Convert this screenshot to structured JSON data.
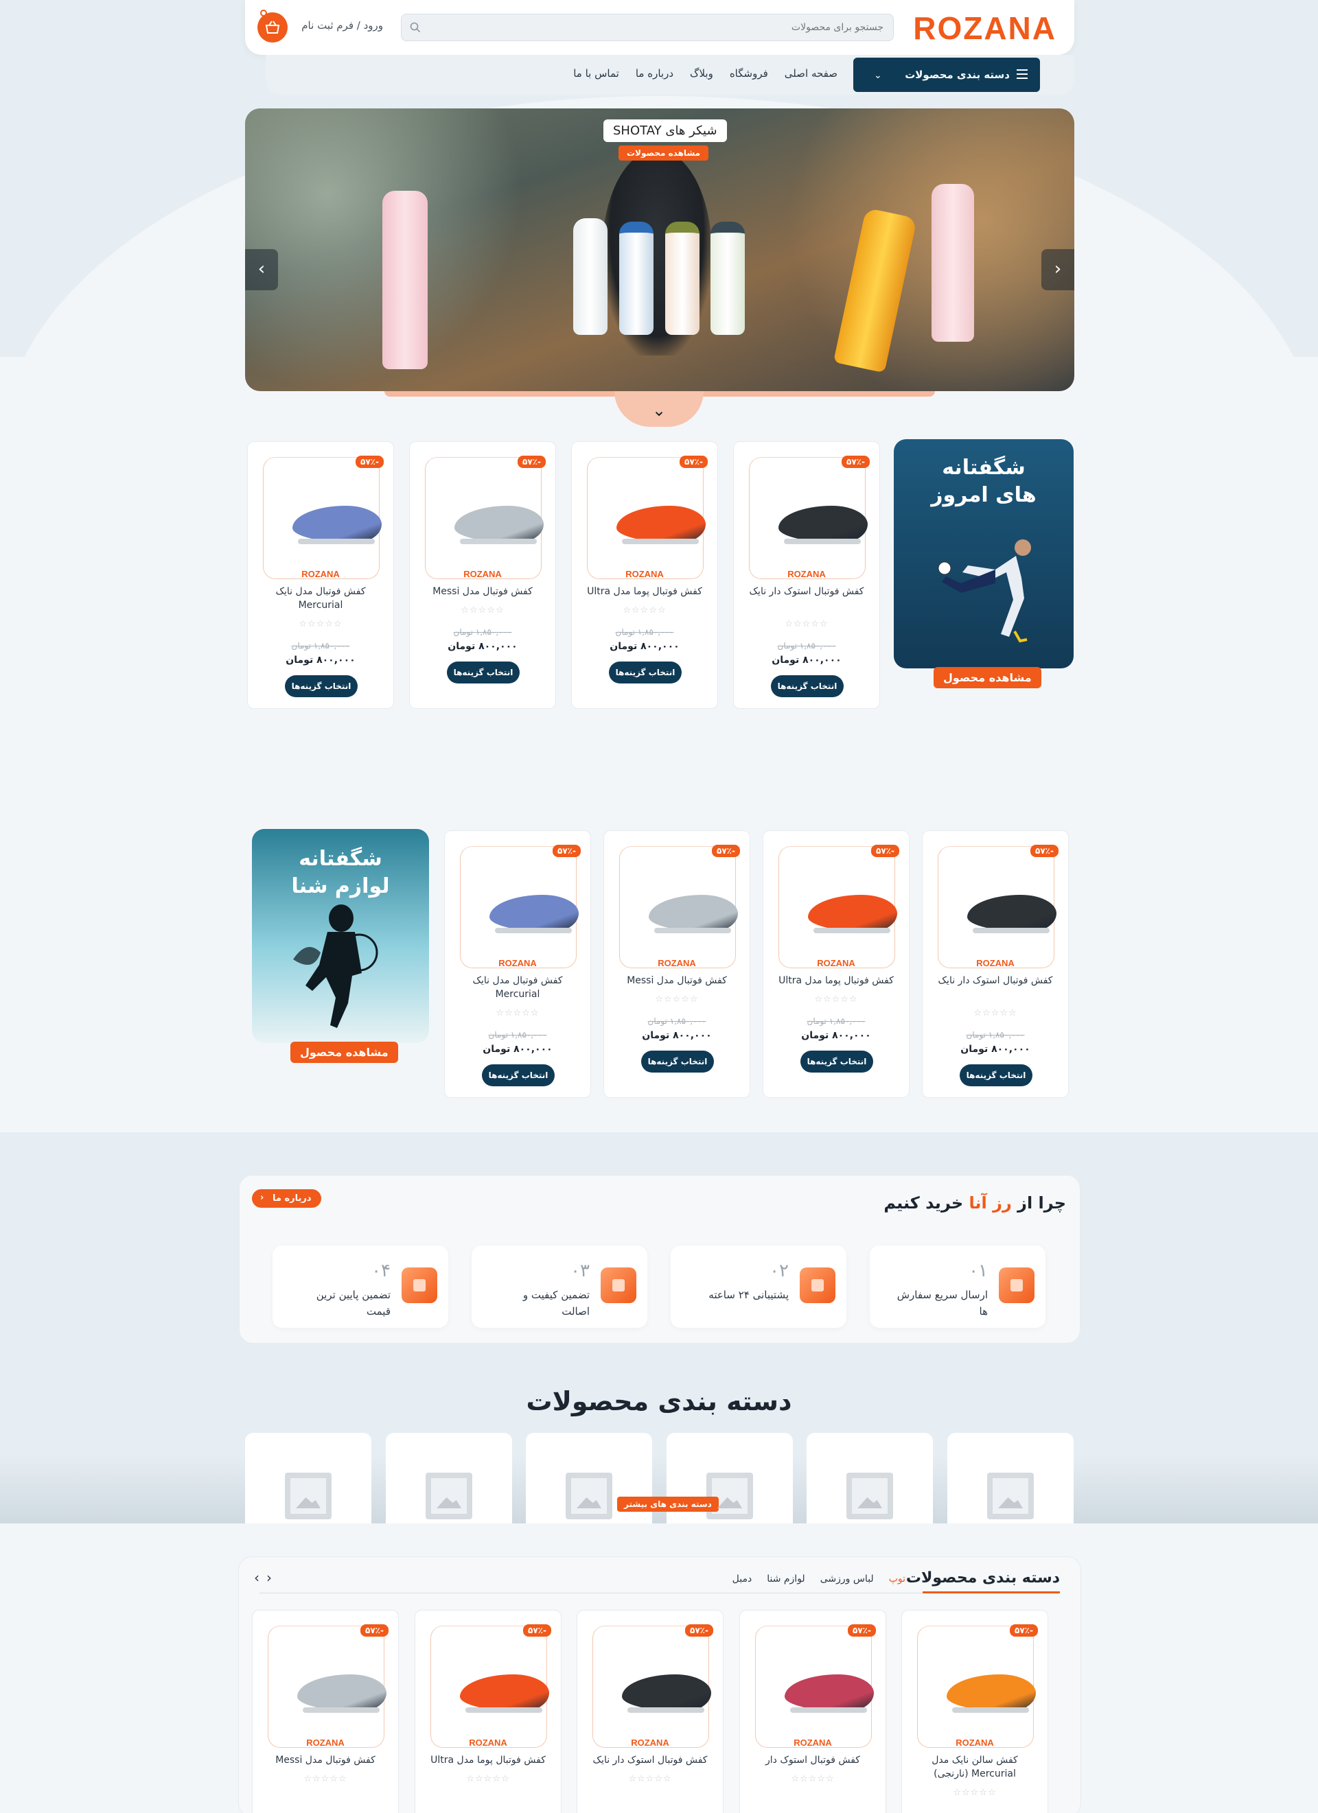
{
  "header": {
    "logo": "ROZANA",
    "search_placeholder": "جستجو برای محصولات",
    "login": "ورود / فرم ثبت نام"
  },
  "nav": {
    "category_menu": "دسته بندی محصولات",
    "links": [
      "صفحه اصلی",
      "فروشگاه",
      "وبلاگ",
      "درباره ما",
      "تماس با ما"
    ]
  },
  "hero": {
    "title": "شیکر های SHOTAY",
    "cta": "مشاهده محصولات"
  },
  "offer1": {
    "title_line1": "شگفتانه",
    "title_line2": "های امروز",
    "button": "مشاهده محصول",
    "products": [
      {
        "title": "کفش فوتبال استوک دار نایک",
        "discount": "-۵۷٪",
        "brand": "ROZANA",
        "stars": "☆☆☆☆☆",
        "old_price": "۱,۸۵۰,۰۰۰ تومان",
        "price": "۸۰۰,۰۰۰ تومان",
        "button": "انتخاب گزینه‌ها",
        "color": "#2d3236"
      },
      {
        "title": "کفش فوتبال پوما مدل Ultra",
        "discount": "-۵۷٪",
        "brand": "ROZANA",
        "stars": "☆☆☆☆☆",
        "old_price": "۱,۸۵۰,۰۰۰ تومان",
        "price": "۸۰۰,۰۰۰ تومان",
        "button": "انتخاب گزینه‌ها",
        "color": "#f0501e"
      },
      {
        "title": "کفش فوتبال مدل Messi",
        "discount": "-۵۷٪",
        "brand": "ROZANA",
        "stars": "☆☆☆☆☆",
        "old_price": "۱,۸۵۰,۰۰۰ تومان",
        "price": "۸۰۰,۰۰۰ تومان",
        "button": "انتخاب گزینه‌ها",
        "color": "#b9c2c8"
      },
      {
        "title": "کفش فوتبال مدل نایک Mercurial",
        "discount": "-۵۷٪",
        "brand": "ROZANA",
        "stars": "☆☆☆☆☆",
        "old_price": "۱,۸۵۰,۰۰۰ تومان",
        "price": "۸۰۰,۰۰۰ تومان",
        "button": "انتخاب گزینه‌ها",
        "color": "#6f86c9"
      }
    ]
  },
  "offer2": {
    "title_line1": "شگفتانه",
    "title_line2": "لوازم شنا",
    "button": "مشاهده محصول",
    "products": [
      {
        "title": "کفش فوتبال استوک دار نایک",
        "discount": "-۵۷٪",
        "brand": "ROZANA",
        "stars": "☆☆☆☆☆",
        "old_price": "۱,۸۵۰,۰۰۰ تومان",
        "price": "۸۰۰,۰۰۰ تومان",
        "button": "انتخاب گزینه‌ها",
        "color": "#2d3236"
      },
      {
        "title": "کفش فوتبال پوما مدل Ultra",
        "discount": "-۵۷٪",
        "brand": "ROZANA",
        "stars": "☆☆☆☆☆",
        "old_price": "۱,۸۵۰,۰۰۰ تومان",
        "price": "۸۰۰,۰۰۰ تومان",
        "button": "انتخاب گزینه‌ها",
        "color": "#f0501e"
      },
      {
        "title": "کفش فوتبال مدل Messi",
        "discount": "-۵۷٪",
        "brand": "ROZANA",
        "stars": "☆☆☆☆☆",
        "old_price": "۱,۸۵۰,۰۰۰ تومان",
        "price": "۸۰۰,۰۰۰ تومان",
        "button": "انتخاب گزینه‌ها",
        "color": "#b9c2c8"
      },
      {
        "title": "کفش فوتبال مدل نایک Mercurial",
        "discount": "-۵۷٪",
        "brand": "ROZANA",
        "stars": "☆☆☆☆☆",
        "old_price": "۱,۸۵۰,۰۰۰ تومان",
        "price": "۸۰۰,۰۰۰ تومان",
        "button": "انتخاب گزینه‌ها",
        "color": "#6f86c9"
      }
    ]
  },
  "why": {
    "title_prefix": "چرا از",
    "title_accent": "رز آنا",
    "title_suffix": "خرید کنیم",
    "about_button": "درباره ما",
    "features": [
      {
        "num": "۰۱",
        "text": "ارسال سریع سفارش ها"
      },
      {
        "num": "۰۲",
        "text": "پشتیبانی ۲۴ ساعته"
      },
      {
        "num": "۰۳",
        "text": "تضمین کیفیت و اصالت"
      },
      {
        "num": "۰۴",
        "text": "تضمین پایین ترین قیمت"
      }
    ]
  },
  "categories": {
    "heading": "دسته بندی محصولات",
    "more_button": "دسته بندی های بیشتر"
  },
  "bottom": {
    "title": "دسته بندی محصولات",
    "tabs": [
      "توپ",
      "لباس ورزشی",
      "لوازم شنا",
      "دمبل"
    ],
    "active_tab": 0,
    "products": [
      {
        "title": "کفش سالن نایک مدل Mercurial (نارنجی)",
        "discount": "-۵۷٪",
        "brand": "ROZANA",
        "stars": "☆☆☆☆☆",
        "color": "#f58a1f"
      },
      {
        "title": "کفش فوتبال استوک دار",
        "discount": "-۵۷٪",
        "brand": "ROZANA",
        "stars": "☆☆☆☆☆",
        "color": "#c2405a"
      },
      {
        "title": "کفش فوتبال استوک دار نایک",
        "discount": "-۵۷٪",
        "brand": "ROZANA",
        "stars": "☆☆☆☆☆",
        "color": "#2d3236"
      },
      {
        "title": "کفش فوتبال پوما مدل Ultra",
        "discount": "-۵۷٪",
        "brand": "ROZANA",
        "stars": "☆☆☆☆☆",
        "color": "#f0501e"
      },
      {
        "title": "کفش فوتبال مدل Messi",
        "discount": "-۵۷٪",
        "brand": "ROZANA",
        "stars": "☆☆☆☆☆",
        "color": "#b9c2c8"
      }
    ]
  },
  "colors": {
    "accent": "#f05a1a",
    "dark": "#0f3a55"
  }
}
